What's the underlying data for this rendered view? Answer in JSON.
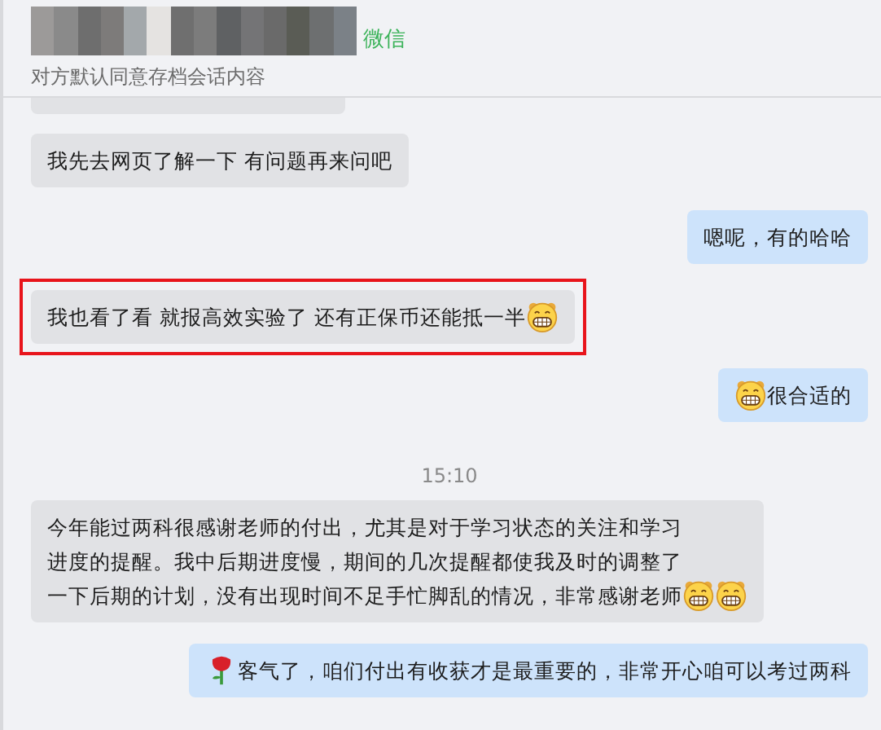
{
  "header": {
    "app_tag": "微信",
    "subtitle": "对方默认同意存档会话内容"
  },
  "messages": [
    {
      "kind": "left",
      "highlighted": false,
      "parts": [
        {
          "kind": "text",
          "text": "我先去网页了解一下 有问题再来问吧"
        }
      ]
    },
    {
      "kind": "right",
      "highlighted": false,
      "parts": [
        {
          "kind": "text",
          "text": "嗯呢，有的哈哈"
        }
      ]
    },
    {
      "kind": "left",
      "highlighted": true,
      "parts": [
        {
          "kind": "text",
          "text": "我也看了看 就报高效实验了 还有正保币还能抵一半"
        },
        {
          "kind": "grin"
        }
      ]
    },
    {
      "kind": "right",
      "highlighted": false,
      "parts": [
        {
          "kind": "grin"
        },
        {
          "kind": "text",
          "text": "很合适的"
        }
      ]
    },
    {
      "kind": "time",
      "text": "15:10"
    },
    {
      "kind": "left",
      "highlighted": false,
      "parts": [
        {
          "kind": "text",
          "text": "今年能过两科很感谢老师的付出，尤其是对于学习状态的关注和学习进度的提醒。我中后期进度慢，期间的几次提醒都使我及时的调整了一下后期的计划，没有出现时间不足手忙脚乱的情况，非常感谢老师"
        },
        {
          "kind": "grin"
        },
        {
          "kind": "grin"
        }
      ]
    },
    {
      "kind": "right",
      "highlighted": false,
      "parts": [
        {
          "kind": "rose"
        },
        {
          "kind": "text",
          "text": "客气了，咱们付出有收获才是最重要的，非常开心咱可以考过两科"
        }
      ]
    }
  ]
}
